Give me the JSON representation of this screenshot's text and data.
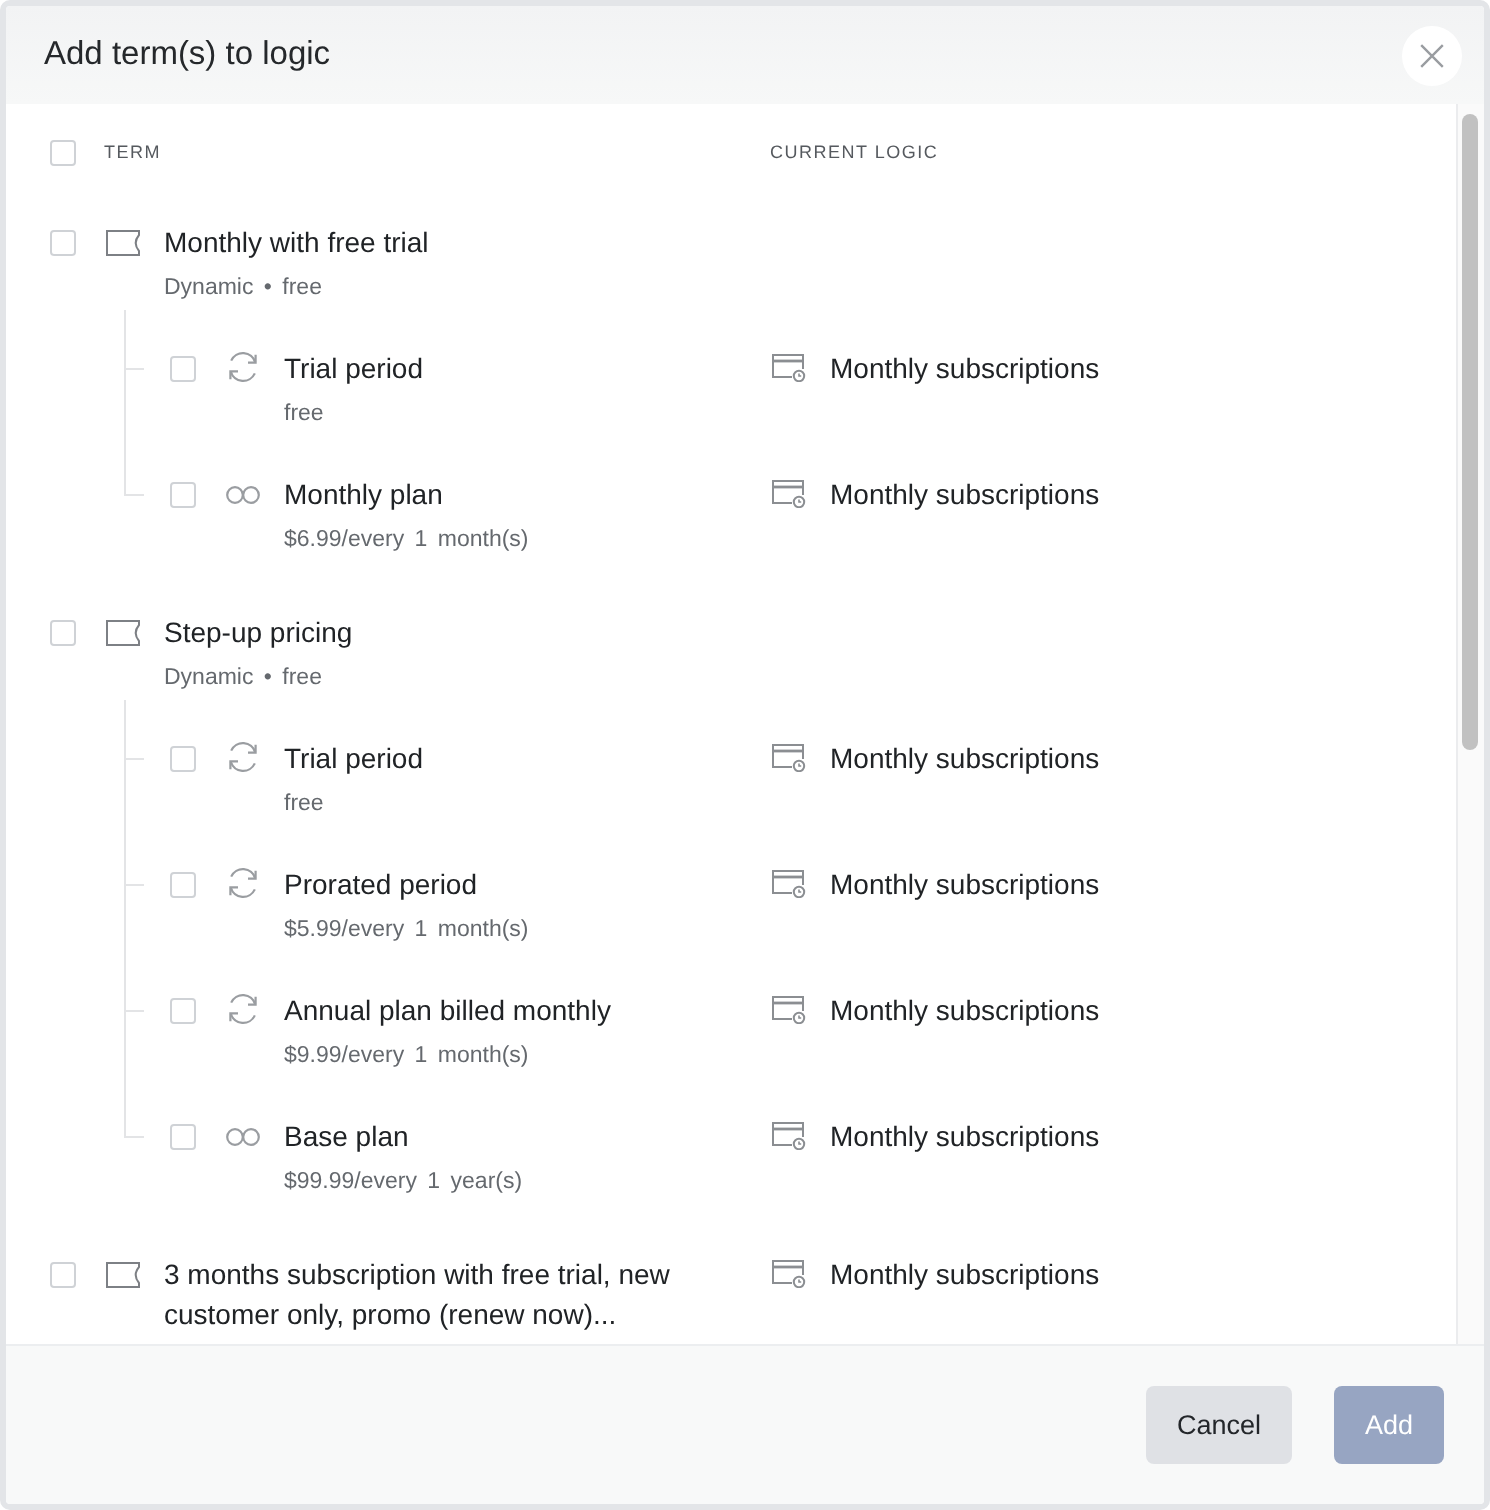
{
  "dialog": {
    "title": "Add term(s) to logic"
  },
  "table": {
    "select_all": {
      "checked": false
    },
    "columns": [
      "TERM",
      "CURRENT LOGIC"
    ],
    "groups": [
      {
        "title": "Monthly with free trial",
        "subtitle": "Dynamic • free",
        "checked": false,
        "children": [
          {
            "kind": "cycle",
            "title": "Trial period",
            "detail": "free",
            "logic": "Monthly subscriptions",
            "checked": false
          },
          {
            "kind": "infinite",
            "title": "Monthly plan",
            "detail": "$6.99/every 1 month(s)",
            "logic": "Monthly subscriptions",
            "checked": false
          }
        ]
      },
      {
        "title": "Step-up pricing",
        "subtitle": "Dynamic • free",
        "checked": false,
        "children": [
          {
            "kind": "cycle",
            "title": "Trial period",
            "detail": "free",
            "logic": "Monthly subscriptions",
            "checked": false
          },
          {
            "kind": "cycle",
            "title": "Prorated period",
            "detail": "$5.99/every 1 month(s)",
            "logic": "Monthly subscriptions",
            "checked": false
          },
          {
            "kind": "cycle",
            "title": "Annual plan billed monthly",
            "detail": "$9.99/every 1 month(s)",
            "logic": "Monthly subscriptions",
            "checked": false
          },
          {
            "kind": "infinite",
            "title": "Base plan",
            "detail": "$99.99/every 1 year(s)",
            "logic": "Monthly subscriptions",
            "checked": false
          }
        ]
      },
      {
        "title": "3 months subscription with free trial, new customer only, promo (renew now)...",
        "logic": "Monthly subscriptions",
        "checked": false
      }
    ]
  },
  "footer": {
    "buttons": [
      {
        "label": "Cancel",
        "kind": "secondary",
        "disabled": false
      },
      {
        "label": "Add",
        "kind": "primary",
        "disabled": true
      }
    ]
  }
}
